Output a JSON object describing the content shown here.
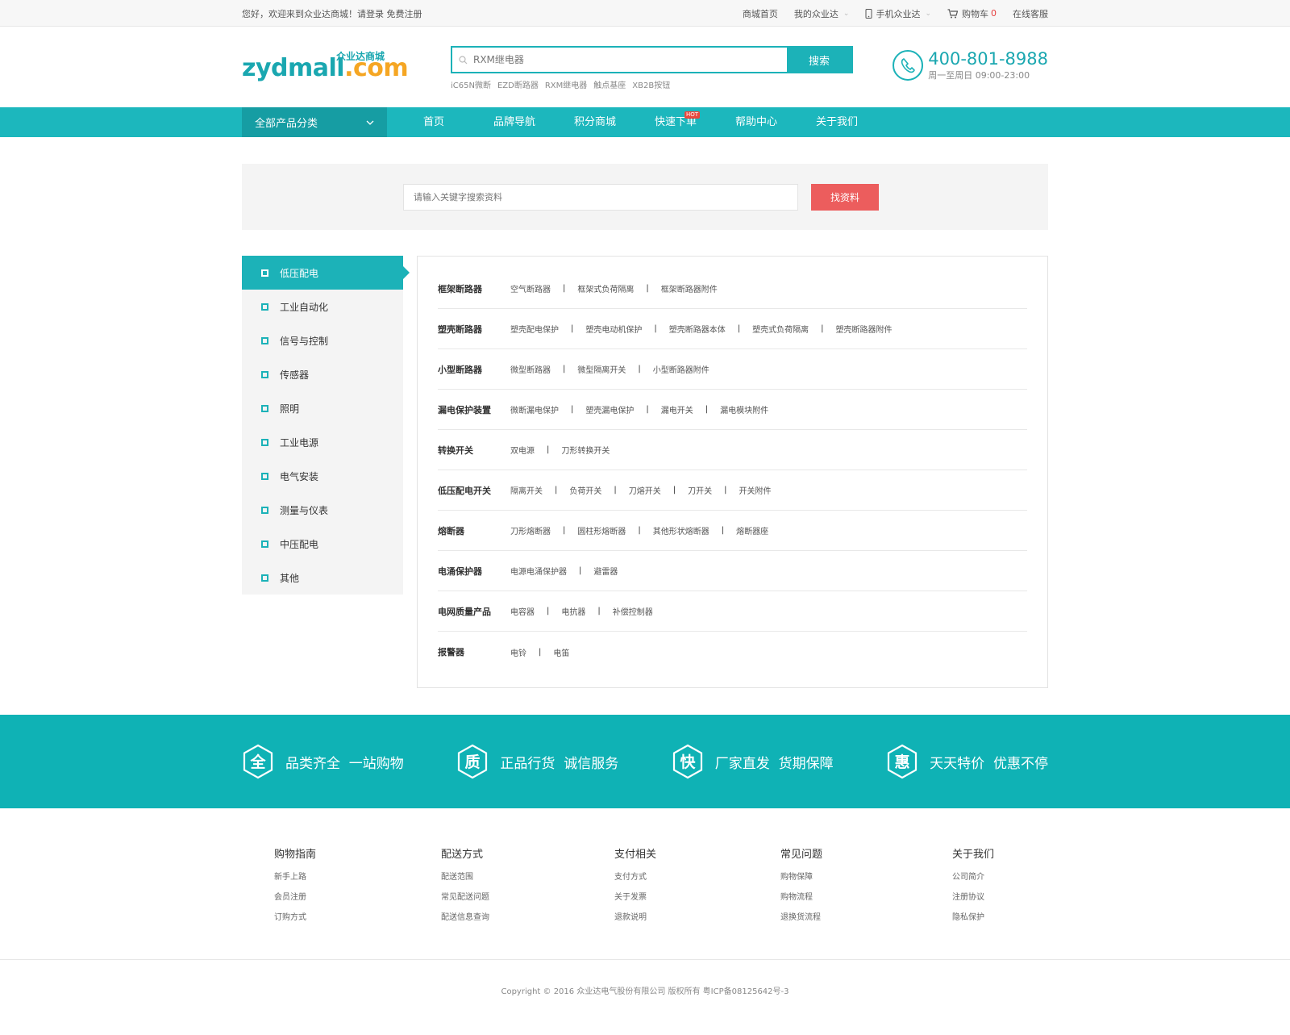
{
  "topbar": {
    "welcome": "您好，欢迎来到众业达商城！请登录 免费注册",
    "links": [
      "商城首页",
      "我的众业达",
      "手机众业达",
      "购物车",
      "在线客服"
    ],
    "cart_count": "0"
  },
  "header": {
    "logo_en_a": "zydmall",
    "logo_en_b": ".com",
    "logo_cn": "众业达商城",
    "search_placeholder": "RXM继电器",
    "search_button": "搜索",
    "hot_words": [
      "iC65N微断",
      "EZD断路器",
      "RXM继电器",
      "触点基座",
      "XB2B按钮"
    ],
    "hotline_number": "400-801-8988",
    "hotline_hours": "周一至周日 09:00-23:00"
  },
  "nav": {
    "all_categories": "全部产品分类",
    "items": [
      "首页",
      "品牌导航",
      "积分商城",
      "快速下单",
      "帮助中心",
      "关于我们"
    ],
    "hot_badge": "HOT"
  },
  "filter": {
    "placeholder": "请输入关键字搜索资料",
    "button": "找资料"
  },
  "sidebar": {
    "items": [
      "低压配电",
      "工业自动化",
      "信号与控制",
      "传感器",
      "照明",
      "工业电源",
      "电气安装",
      "测量与仪表",
      "中压配电",
      "其他"
    ]
  },
  "categories": [
    {
      "title": "框架断路器",
      "links": [
        "空气断路器",
        "框架式负荷隔离",
        "框架断路器附件"
      ]
    },
    {
      "title": "塑壳断路器",
      "links": [
        "塑壳配电保护",
        "塑壳电动机保护",
        "塑壳断路器本体",
        "塑壳式负荷隔离",
        "塑壳断路器附件"
      ]
    },
    {
      "title": "小型断路器",
      "links": [
        "微型断路器",
        "微型隔离开关",
        "小型断路器附件"
      ]
    },
    {
      "title": "漏电保护装置",
      "links": [
        "微断漏电保护",
        "塑壳漏电保护",
        "漏电开关",
        "漏电模块附件"
      ]
    },
    {
      "title": "转换开关",
      "links": [
        "双电源",
        "刀形转换开关"
      ]
    },
    {
      "title": "低压配电开关",
      "links": [
        "隔离开关",
        "负荷开关",
        "刀熔开关",
        "刀开关",
        "开关附件"
      ]
    },
    {
      "title": "熔断器",
      "links": [
        "刀形熔断器",
        "圆柱形熔断器",
        "其他形状熔断器",
        "熔断器座"
      ]
    },
    {
      "title": "电涌保护器",
      "links": [
        "电源电涌保护器",
        "避雷器"
      ]
    },
    {
      "title": "电网质量产品",
      "links": [
        "电容器",
        "电抗器",
        "补偿控制器"
      ]
    },
    {
      "title": "报警器",
      "links": [
        "电铃",
        "电笛"
      ]
    }
  ],
  "features": [
    {
      "icon": "全",
      "text": "品类齐全  一站购物"
    },
    {
      "icon": "质",
      "text": "正品行货  诚信服务"
    },
    {
      "icon": "快",
      "text": "厂家直发  货期保障"
    },
    {
      "icon": "惠",
      "text": "天天特价  优惠不停"
    }
  ],
  "footer": {
    "columns": [
      {
        "title": "购物指南",
        "links": [
          "新手上路",
          "会员注册",
          "订购方式"
        ]
      },
      {
        "title": "配送方式",
        "links": [
          "配送范围",
          "常见配送问题",
          "配送信息查询"
        ]
      },
      {
        "title": "支付相关",
        "links": [
          "支付方式",
          "关于发票",
          "退款说明"
        ]
      },
      {
        "title": "常见问题",
        "links": [
          "购物保障",
          "购物流程",
          "退换货流程"
        ]
      },
      {
        "title": "关于我们",
        "links": [
          "公司简介",
          "注册协议",
          "隐私保护"
        ]
      }
    ],
    "copyright": "Copyright © 2016 众业达电气股份有限公司 版权所有 粤ICP备08125642号-3"
  },
  "colors": {
    "primary": "#1cb2b8",
    "accent": "#ec5d5d",
    "logo_orange": "#f5a623"
  }
}
